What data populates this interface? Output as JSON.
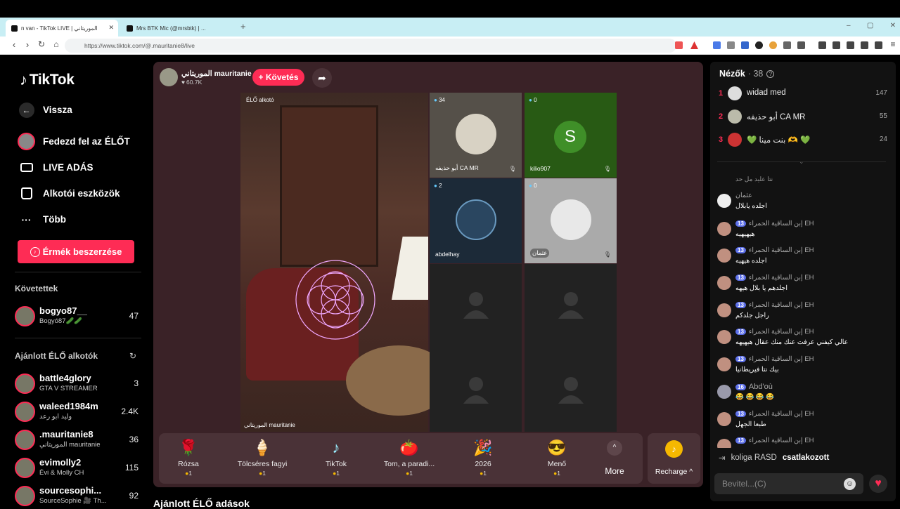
{
  "browser": {
    "tabs": [
      {
        "label": "n van - TikTok LIVE | الموريتاني",
        "active": true
      },
      {
        "label": "Mrs BTK Mic (@mrsbtk) | ...",
        "active": false
      }
    ],
    "new_tab": "+",
    "url": "https://www.tiktok.com/@.mauritanie8/live",
    "window_controls": [
      "–",
      "▢",
      "✕"
    ]
  },
  "sidebar": {
    "logo": "TikTok",
    "back": "Vissza",
    "menu": [
      {
        "label": "Fedezd fel az ÉLŐT",
        "icon": "live-avatar-icon"
      },
      {
        "label": "LIVE ADÁS",
        "icon": "camera-icon"
      },
      {
        "label": "Alkotói eszközök",
        "icon": "creator-tools-icon"
      },
      {
        "label": "Több",
        "icon": "more-dots-icon"
      }
    ],
    "coins_button": "Érmék beszerzése",
    "following_header": "Követettek",
    "following": [
      {
        "name": "bogyo87__",
        "sub": "Bogyó87🥒🥒",
        "count": "47"
      }
    ],
    "recommended_header": "Ajánlott ÉLŐ alkotók",
    "recommended": [
      {
        "name": "battle4glory",
        "sub": "GTA V STREAMER",
        "count": "3"
      },
      {
        "name": "waleed1984m",
        "sub": "وليد ابو رعد",
        "count": "2.4K"
      },
      {
        "name": ".mauritanie8",
        "sub": "الموريتاني mauritanie",
        "count": "36"
      },
      {
        "name": "evimolly2",
        "sub": "Évi & Molly CH",
        "count": "115"
      },
      {
        "name": "sourcesophi...",
        "sub": "SourceSophie 🎥 Th...",
        "count": "92"
      }
    ],
    "bottom_section": "Ajánlott ÉLŐ adások"
  },
  "stream": {
    "host_name": "الموريتاني mauritanie",
    "host_likes": "60.7K",
    "follow_button": "+ Követés",
    "main_label": "ÉLŐ alkotó",
    "main_caption": "الموريتاني mauritanie",
    "guests": [
      {
        "name": "أبو حذيفه CA MR",
        "count": "34",
        "muted": true,
        "avatar": "moon"
      },
      {
        "name": "kilio907",
        "count": "0",
        "muted": true,
        "avatar": "S"
      },
      {
        "name": "abdelhay",
        "count": "2",
        "muted": false,
        "avatar": "calligraphy"
      },
      {
        "name": "عثمان",
        "count": "0",
        "muted": true,
        "avatar": "blank"
      }
    ],
    "gifts": [
      {
        "name": "Rózsa",
        "price": "1",
        "icon": "🌹"
      },
      {
        "name": "Tölcséres fagyi",
        "price": "1",
        "icon": "🍦"
      },
      {
        "name": "TikTok",
        "price": "1",
        "icon": "♪"
      },
      {
        "name": "Tom, a paradi...",
        "price": "1",
        "icon": "🍅"
      },
      {
        "name": "2026",
        "price": "1",
        "icon": "🎉"
      },
      {
        "name": "Menő",
        "price": "1",
        "icon": "😎"
      }
    ],
    "more_label": "More",
    "recharge_label": "Recharge ^"
  },
  "chat": {
    "viewers_title": "Nézők",
    "viewers_count": "· 38",
    "top_viewers": [
      {
        "rank": "1",
        "name": "widad med",
        "score": "147"
      },
      {
        "rank": "2",
        "name": "أبو حذيفه CA MR",
        "score": "55"
      },
      {
        "rank": "3",
        "name": "💚 بنت مينا 🫶 💚",
        "score": "24"
      }
    ],
    "partial_message": "نتا عليد مل حد",
    "messages": [
      {
        "user": "عثمان",
        "level": "",
        "text": "اجلده يابلال"
      },
      {
        "user": "إبن الساقية الحمراء EH",
        "level": "13",
        "text": "هيهيهيه"
      },
      {
        "user": "إبن الساقية الحمراء EH",
        "level": "13",
        "text": "اجلده هيهيه"
      },
      {
        "user": "إبن الساقية الحمراء EH",
        "level": "13",
        "text": "اجلدهم يا بلال هيهه"
      },
      {
        "user": "إبن الساقية الحمراء EH",
        "level": "13",
        "text": "راجل جلدكم"
      },
      {
        "user": "إبن الساقية الحمراء EH",
        "level": "13",
        "text": "عالي كيفني عرفت عنك منك عقال هيهيهه"
      },
      {
        "user": "إبن الساقية الحمراء EH",
        "level": "13",
        "text": "بيك نتا فيريطانيا"
      },
      {
        "user": "Abd'où",
        "level": "16",
        "text": "😂 😂 😂 😂"
      },
      {
        "user": "إبن الساقية الحمراء EH",
        "level": "13",
        "text": "طبعا الجهل"
      },
      {
        "user": "إبن الساقية الحمراء EH",
        "level": "13",
        "text": ""
      }
    ],
    "join_user": "koliga RASD",
    "join_text": "csatlakozott",
    "input_placeholder": "Bevitel...(C)"
  }
}
